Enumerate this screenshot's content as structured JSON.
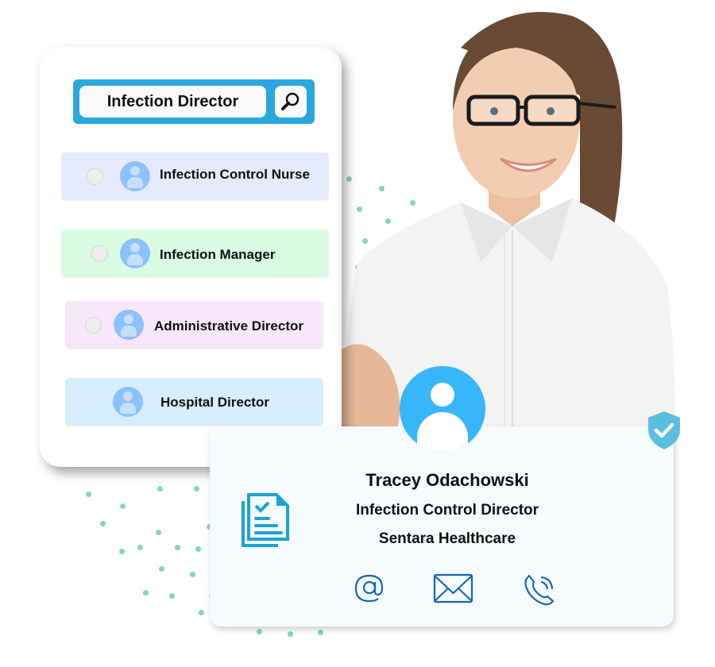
{
  "search": {
    "query": "Infection Director",
    "button_icon": "search-icon"
  },
  "roles": [
    {
      "label": "Infection Control Nurse",
      "icon": "user-avatar-icon",
      "has_radio": true,
      "bg": "#e5eafc"
    },
    {
      "label": "Infection Manager",
      "icon": "user-avatar-icon",
      "has_radio": true,
      "bg": "#d9fbe2"
    },
    {
      "label": "Administrative Director",
      "icon": "user-avatar-icon",
      "has_radio": true,
      "bg": "#f8e6fb"
    },
    {
      "label": "Hospital Director",
      "icon": "user-avatar-icon",
      "has_radio": false,
      "bg": "#d6eefd"
    }
  ],
  "profile": {
    "name": "Tracey Odachowski",
    "title": "Infection Control Director",
    "organization": "Sentara Healthcare",
    "verified": true,
    "contacts": [
      {
        "type": "email-address",
        "icon": "at-sign-icon"
      },
      {
        "type": "mail",
        "icon": "envelope-icon"
      },
      {
        "type": "phone",
        "icon": "phone-icon"
      }
    ]
  },
  "colors": {
    "accent": "#29a8e0",
    "avatar_blue": "#38b6fb",
    "icon_blue": "#1565c0",
    "doc_icon": "#1aa3d4",
    "dots": "#7dd7c6"
  }
}
